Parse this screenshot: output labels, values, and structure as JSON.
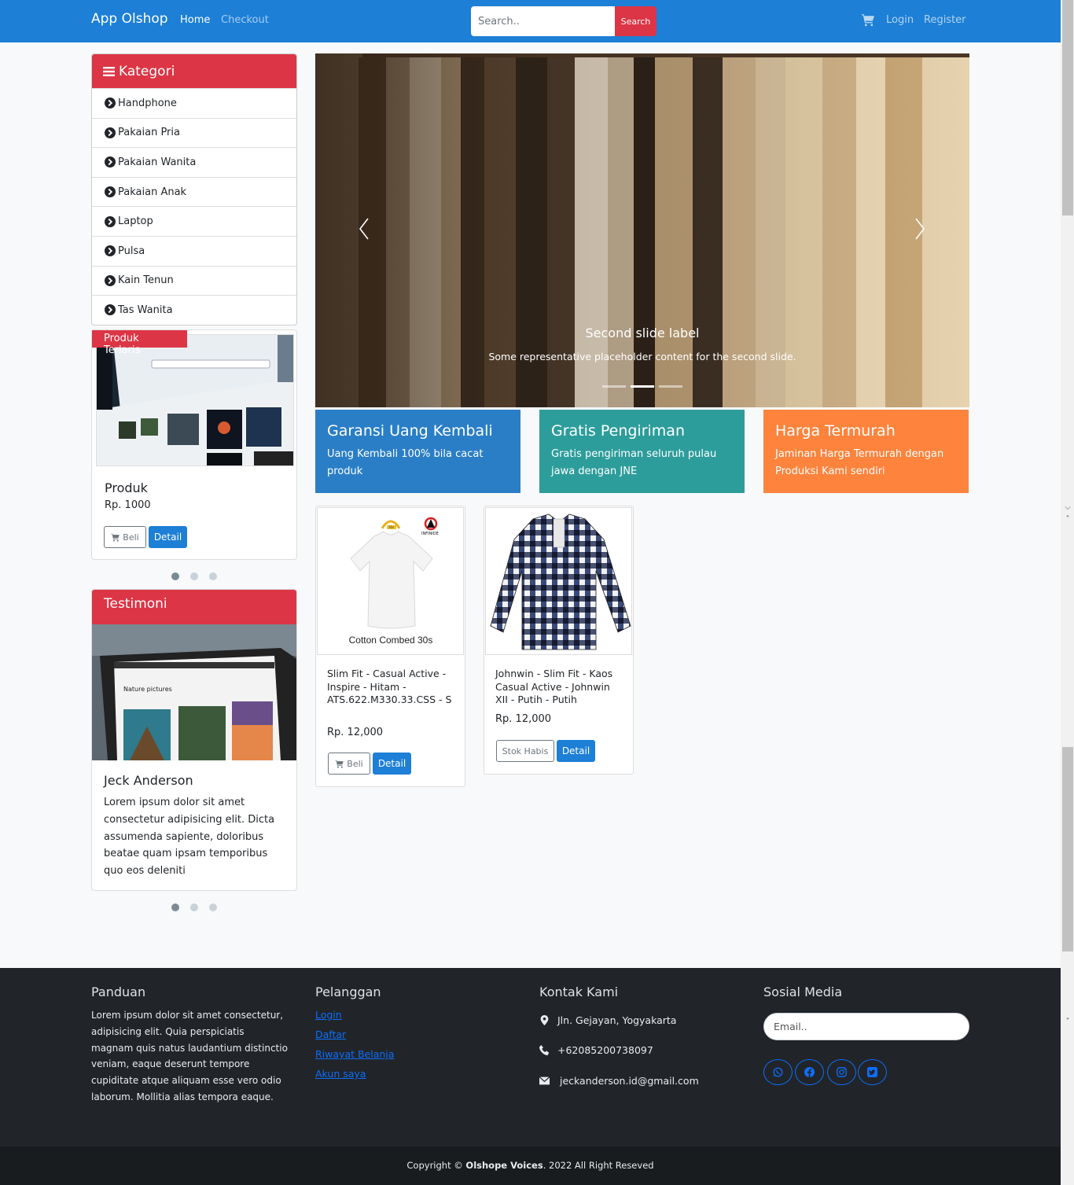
{
  "navbar": {
    "brand": "App Olshop",
    "home": "Home",
    "checkout": "Checkout",
    "search_placeholder": "Search..",
    "search_button": "Search",
    "login": "Login",
    "register": "Register"
  },
  "kategori": {
    "title": "Kategori",
    "items": [
      "Handphone",
      "Pakaian Pria",
      "Pakaian Wanita",
      "Pakaian Anak",
      "Laptop",
      "Pulsa",
      "Kain Tenun",
      "Tas Wanita"
    ]
  },
  "terlaris": {
    "badge": "Produk Terlaris",
    "name": "Produk",
    "price": "Rp. 1000",
    "buy": "Beli",
    "detail": "Detail"
  },
  "testimoni": {
    "title": "Testimoni",
    "name": "Jeck Anderson",
    "text": "Lorem ipsum dolor sit amet consectetur adipisicing elit. Dicta assumenda sapiente, doloribus beatae quam ipsam temporibus quo eos deleniti",
    "image_heading": "Nature pictures"
  },
  "carousel": {
    "title": "Second slide label",
    "text": "Some representative placeholder content for the second slide.",
    "slides": 3,
    "active_slide": 2
  },
  "features": [
    {
      "title": "Garansi Uang Kembali",
      "text": "Uang Kembali 100% bila cacat produk",
      "color": "#2a7ec6"
    },
    {
      "title": "Gratis Pengiriman",
      "text": "Gratis pengiriman seluruh pulau jawa dengan JNE",
      "color": "#2d9d9b"
    },
    {
      "title": "Harga Termurah",
      "text": "Jaminan Harga Termurah dengan Produksi Kami sendiri",
      "color": "#fe833c"
    }
  ],
  "products": [
    {
      "name": "Slim Fit - Casual Active - Inspire - Hitam - ATS.622.M330.33.CSS - S",
      "price": "Rp. 12,000",
      "action": "Beli",
      "detail": "Detail",
      "image_caption": "Cotton Combed 30s",
      "brand_mark": "INFINIDE",
      "size_tag": "30s"
    },
    {
      "name": "Johnwin - Slim Fit - Kaos Casual Active - Johnwin XII - Putih - Putih",
      "price": "Rp. 12,000",
      "action": "Stok Habis",
      "detail": "Detail"
    }
  ],
  "footer": {
    "panduan_title": "Panduan",
    "panduan_text": "Lorem ipsum dolor sit amet consectetur, adipisicing elit. Quia perspiciatis magnam quis natus laudantium distinctio veniam, eaque deserunt tempore cupiditate atque aliquam esse vero odio laborum. Mollitia alias tempora eaque.",
    "pelanggan_title": "Pelanggan",
    "links": [
      "Login",
      "Daftar",
      "Riwayat Belanja",
      "Akun saya"
    ],
    "kontak_title": "Kontak Kami",
    "address": "Jln. Gejayan, Yogyakarta",
    "phone": "+62085200738097",
    "email": "jeckanderson.id@gmail.com",
    "sosial_title": "Sosial Media",
    "email_placeholder": "Email..",
    "copyright_prefix": "Copyright © ",
    "copyright_brand": "Olshope Voices",
    "copyright_suffix": ". 2022 All Right Reseved"
  },
  "colors": {
    "navbar": "#1d7fd6",
    "danger": "#dc3545",
    "primary": "#1d7fd6",
    "footer": "#212529"
  },
  "icons": [
    "cart-icon",
    "bars-icon",
    "chevron-circle-right-icon",
    "map-marker-icon",
    "phone-icon",
    "envelope-icon",
    "whatsapp-icon",
    "facebook-icon",
    "instagram-icon",
    "twitter-icon"
  ]
}
